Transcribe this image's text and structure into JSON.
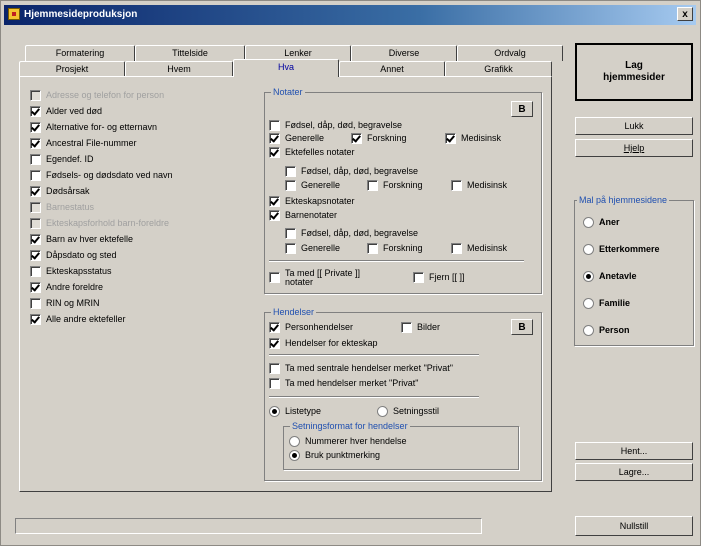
{
  "window": {
    "title": "Hjemmesideproduksjon",
    "close": "x"
  },
  "tabs_back": [
    "Formatering",
    "Tittelside",
    "Lenker",
    "Diverse",
    "Ordvalg"
  ],
  "tabs_front": [
    "Prosjekt",
    "Hvem",
    "Hva",
    "Annet",
    "Grafikk"
  ],
  "active_tab": "Hva",
  "left_list": [
    {
      "label": "Adresse og telefon for person",
      "checked": false,
      "disabled": true
    },
    {
      "label": "Alder ved død",
      "checked": true,
      "disabled": false
    },
    {
      "label": "Alternative for- og etternavn",
      "checked": true,
      "disabled": false
    },
    {
      "label": "Ancestral File-nummer",
      "checked": true,
      "disabled": false
    },
    {
      "label": "Egendef. ID",
      "checked": false,
      "disabled": false
    },
    {
      "label": "Fødsels- og dødsdato ved navn",
      "checked": false,
      "disabled": false
    },
    {
      "label": "Dødsårsak",
      "checked": true,
      "disabled": false
    },
    {
      "label": "Barnestatus",
      "checked": false,
      "disabled": true
    },
    {
      "label": "Ekteskapsforhold barn-foreldre",
      "checked": false,
      "disabled": true
    },
    {
      "label": "Barn av hver ektefelle",
      "checked": true,
      "disabled": false
    },
    {
      "label": "Dåpsdato og sted",
      "checked": true,
      "disabled": false
    },
    {
      "label": "Ekteskapsstatus",
      "checked": false,
      "disabled": false
    },
    {
      "label": "Andre foreldre",
      "checked": true,
      "disabled": false
    },
    {
      "label": "RIN og MRIN",
      "checked": false,
      "disabled": false
    },
    {
      "label": "Alle andre ektefeller",
      "checked": true,
      "disabled": false
    }
  ],
  "notater": {
    "title": "Notater",
    "btn": "B",
    "birth_line": "Fødsel, dåp, død, begravelse",
    "generelle": "Generelle",
    "forskning": "Forskning",
    "medisinsk": "Medisinsk",
    "felles": "Ektefelles notater",
    "ekteskap": "Ekteskapsnotater",
    "barn": "Barnenotater",
    "private": "Ta med [[ Private ]] notater",
    "fjern": "Fjern [[ ]]"
  },
  "hendelser": {
    "title": "Hendelser",
    "btn": "B",
    "person": "Personhendelser",
    "bilder": "Bilder",
    "ekteskap": "Hendelser for ekteskap",
    "sentrale": "Ta med sentrale hendelser merket \"Privat\"",
    "private": "Ta med hendelser merket \"Privat\"",
    "listetype": "Listetype",
    "setningsstil": "Setningsstil",
    "format_title": "Setningsformat for hendelser",
    "nummerer": "Nummerer hver hendelse",
    "punkt": "Bruk punktmerking"
  },
  "right": {
    "lag": "Lag hjemmesider",
    "lukk": "Lukk",
    "hjelp": "Hjelp",
    "group_title": "Mal på hjemmesidene",
    "options": [
      "Aner",
      "Etterkommere",
      "Anetavle",
      "Familie",
      "Person"
    ],
    "selected": "Anetavle",
    "hent": "Hent...",
    "lagre": "Lagre...",
    "nullstill": "Nullstill"
  },
  "colors": {
    "titlebar_start": "#0a246a",
    "face": "#d4d0c8",
    "group_title": "#2050b0",
    "active_tab": "#0000a0"
  }
}
